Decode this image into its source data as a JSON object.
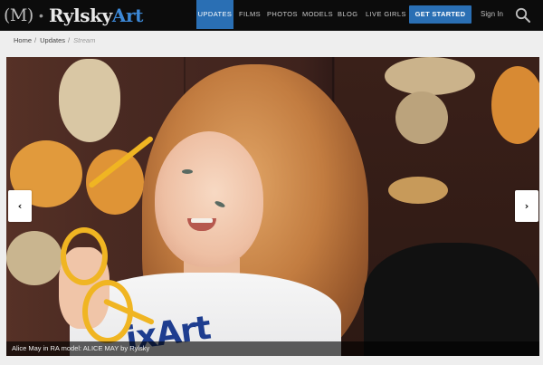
{
  "brand": {
    "mark": "(M)",
    "dot": "•",
    "name_main": "Rylsky",
    "name_accent": "Art",
    "accent_color": "#3c88d6"
  },
  "nav": {
    "items": [
      {
        "label": "UPDATES",
        "active": true
      },
      {
        "label": "FILMS",
        "active": false
      },
      {
        "label": "PHOTOS",
        "active": false
      },
      {
        "label": "MODELS",
        "active": false
      },
      {
        "label": "BLOG",
        "active": false
      },
      {
        "label": "LIVE GIRLS",
        "active": false,
        "caret": "▼"
      }
    ],
    "cta_label": "GET STARTED",
    "signin_label": "Sign In",
    "search_icon": "search-icon",
    "active_color": "#2a6fb4"
  },
  "breadcrumb": {
    "items": [
      "Home",
      "Updates"
    ],
    "separator": "/",
    "current": "Stream"
  },
  "gallery": {
    "prev_label": "‹",
    "next_label": "›",
    "caption": "Alice May in RA model: ALICE MAY by Rylsky",
    "shirt_text": "ixArt"
  }
}
